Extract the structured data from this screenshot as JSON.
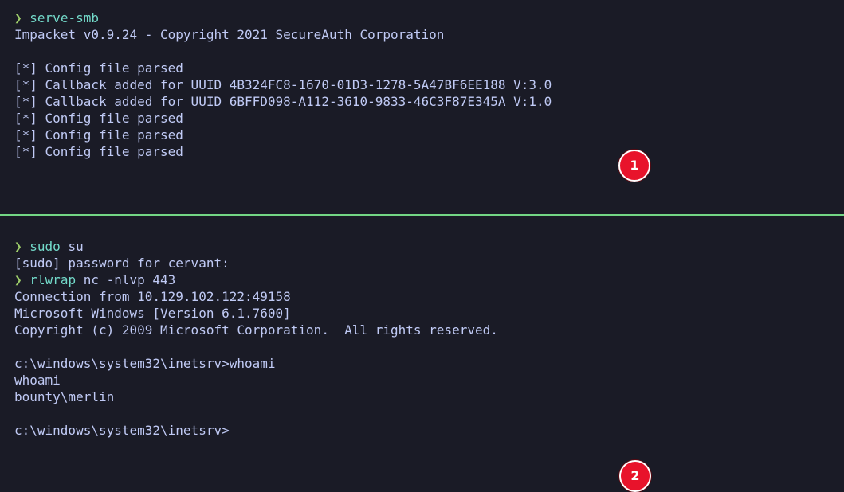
{
  "colors": {
    "background": "#1a1b26",
    "foreground": "#c0caf5",
    "prompt_arrow": "#9ece6a",
    "command": "#73daca",
    "divider": "#73d685",
    "badge": "#e8132b"
  },
  "top_pane": {
    "prompt_symbol": "❯",
    "command": "serve-smb",
    "output": [
      "Impacket v0.9.24 - Copyright 2021 SecureAuth Corporation",
      "",
      "[*] Config file parsed",
      "[*] Callback added for UUID 4B324FC8-1670-01D3-1278-5A47BF6EE188 V:3.0",
      "[*] Callback added for UUID 6BFFD098-A112-3610-9833-46C3F87E345A V:1.0",
      "[*] Config file parsed",
      "[*] Config file parsed",
      "[*] Config file parsed"
    ],
    "badge": "1"
  },
  "bottom_pane": {
    "prompt1": {
      "symbol": "❯",
      "command": "sudo",
      "args": " su"
    },
    "sudo_prompt": "[sudo] password for cervant:",
    "prompt2": {
      "symbol": "❯",
      "command": "rlwrap",
      "args": " nc -nlvp 443"
    },
    "output": [
      "Connection from 10.129.102.122:49158",
      "Microsoft Windows [Version 6.1.7600]",
      "Copyright (c) 2009 Microsoft Corporation.  All rights reserved.",
      "",
      "c:\\windows\\system32\\inetsrv>whoami",
      "whoami",
      "bounty\\merlin",
      "",
      "c:\\windows\\system32\\inetsrv>"
    ],
    "badge": "2"
  }
}
